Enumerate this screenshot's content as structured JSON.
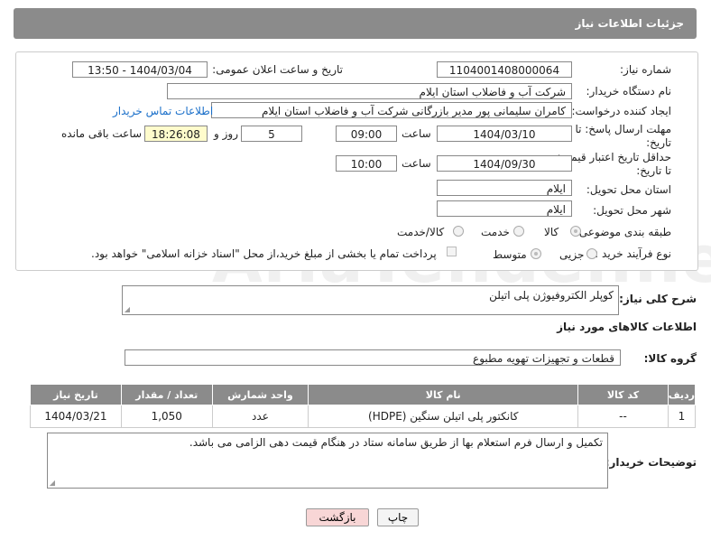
{
  "header": {
    "title": "جزئیات اطلاعات نیاز"
  },
  "form": {
    "need_number_label": "شماره نیاز:",
    "need_number": "1104001408000064",
    "announce_label": "تاریخ و ساعت اعلان عمومی:",
    "announce_value": "1404/03/04 - 13:50",
    "buyer_org_label": "نام دستگاه خریدار:",
    "buyer_org": "شرکت آب و فاضلاب استان ایلام",
    "creator_label": "ایجاد کننده درخواست:",
    "creator": "کامران سلیمانی پور مدیر بازرگانی شرکت آب و فاضلاب استان ایلام",
    "contact_link": "اطلاعات تماس خریدار",
    "deadline_label_1": "مهلت ارسال پاسخ: تا",
    "deadline_label_2": "تاریخ:",
    "deadline_date": "1404/03/10",
    "time_label": "ساعت",
    "deadline_time": "09:00",
    "days_value": "5",
    "days_label": "روز و",
    "remaining_time": "18:26:08",
    "remaining_label": "ساعت باقی مانده",
    "validity_label_1": "حداقل تاریخ اعتبار قیمت:",
    "validity_label_2": "تا تاریخ:",
    "validity_date": "1404/09/30",
    "validity_time": "10:00",
    "province_label": "استان محل تحویل:",
    "province": "ایلام",
    "city_label": "شهر محل تحویل:",
    "city": "ایلام",
    "category_label": "طبقه بندی موضوعی:",
    "category_options": [
      "کالا",
      "خدمت",
      "کالا/خدمت"
    ],
    "process_label": "نوع فرآیند خرید :",
    "process_options": [
      "جزیی",
      "متوسط"
    ],
    "payment_note": "پرداخت تمام یا بخشی از مبلغ خرید،از محل \"اسناد خزانه اسلامی\" خواهد بود."
  },
  "description": {
    "label": "شرح کلی نیاز:",
    "value": "کوپلر الکتروفیوژن پلی اتیلن"
  },
  "goods": {
    "section_title": "اطلاعات کالاهای مورد نیاز",
    "group_label": "گروه کالا:",
    "group_value": "قطعات و تجهیزات تهویه مطبوع",
    "columns": [
      "ردیف",
      "کد کالا",
      "نام کالا",
      "واحد شمارش",
      "تعداد / مقدار",
      "تاریخ نیاز"
    ],
    "rows": [
      [
        "1",
        "--",
        "کانکتور پلی اتیلن سنگین (HDPE)",
        "عدد",
        "1,050",
        "1404/03/21"
      ]
    ]
  },
  "buyer_notes": {
    "label": "توضیحات خریدار:",
    "value": "تکمیل و ارسال فرم استعلام بها از طریق سامانه ستاد در هنگام قیمت دهی الزامی می باشد."
  },
  "buttons": {
    "print": "چاپ",
    "back": "بازگشت"
  },
  "watermark": "AriaTender.neT",
  "colors": {
    "header_bg": "#8b8b8b",
    "link": "#1a6fc9",
    "back_button_bg": "#f8d6d6",
    "highlight_box": "#fffccc"
  }
}
